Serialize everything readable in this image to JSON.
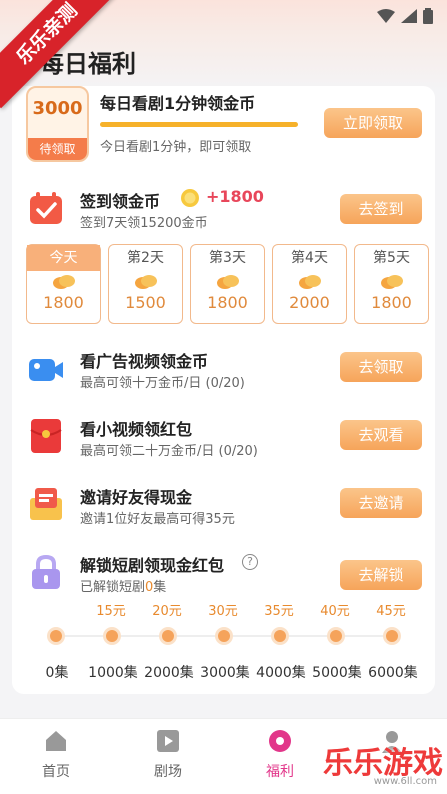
{
  "badge": "乐乐亲测",
  "title": "每日福利",
  "daily_watch": {
    "coins": "3000",
    "status": "待领取",
    "title": "每日看剧1分钟领金币",
    "desc": "今日看剧1分钟，即可领取",
    "button": "立即领取"
  },
  "signin": {
    "title": "签到领金币",
    "bonus": "+1800",
    "desc": "签到7天领15200金币",
    "button": "去签到",
    "days": [
      {
        "label": "今天",
        "value": "1800"
      },
      {
        "label": "第2天",
        "value": "1500"
      },
      {
        "label": "第3天",
        "value": "1800"
      },
      {
        "label": "第4天",
        "value": "2000"
      },
      {
        "label": "第5天",
        "value": "1800"
      }
    ]
  },
  "tasks": [
    {
      "title": "看广告视频领金币",
      "desc": "最高可领十万金币/日 (0/20)",
      "button": "去领取"
    },
    {
      "title": "看小视频领红包",
      "desc": "最高可领二十万金币/日 (0/20)",
      "button": "去观看"
    },
    {
      "title": "邀请好友得现金",
      "desc": "邀请1位好友最高可得35元",
      "button": "去邀请"
    }
  ],
  "unlock": {
    "title": "解锁短剧领现金红包",
    "desc_prefix": "已解锁短剧",
    "desc_count": "0",
    "desc_suffix": "集",
    "button": "去解锁",
    "rewards": [
      "15元",
      "20元",
      "30元",
      "35元",
      "40元",
      "45元"
    ],
    "episodes": [
      "0集",
      "1000集",
      "2000集",
      "3000集",
      "4000集",
      "5000集",
      "6000集"
    ]
  },
  "tabs": [
    {
      "label": "首页"
    },
    {
      "label": "剧场"
    },
    {
      "label": "福利"
    }
  ],
  "watermark": "乐乐游戏",
  "watermark_sub": "www.6ll.com",
  "colors": {
    "accent": "#f6a45a",
    "active_tab": "#e2368a",
    "badge": "#d8232a"
  }
}
